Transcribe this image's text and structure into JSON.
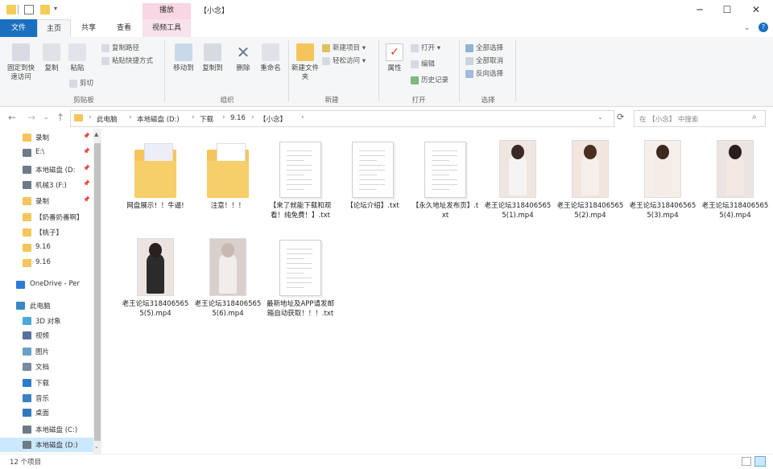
{
  "window": {
    "title": "【小念】",
    "context_tab_header": "播放",
    "buttons": {
      "minimize": "─",
      "maximize": "☐",
      "close": "✕"
    }
  },
  "ribbon_tabs": [
    "文件",
    "主页",
    "共享",
    "查看",
    "视频工具"
  ],
  "ribbon": {
    "clipboard": {
      "pin": "固定到快速访问",
      "copy": "复制",
      "paste": "粘贴",
      "copy_path": "复制路径",
      "paste_shortcut": "粘贴快捷方式",
      "cut": "剪切",
      "label": "剪贴板"
    },
    "organize": {
      "move_to": "移动到",
      "copy_to": "复制到",
      "delete": "删除",
      "rename": "重命名",
      "label": "组织"
    },
    "new": {
      "new_folder": "新建文件夹",
      "new_item": "新建项目",
      "easy_access": "轻松访问",
      "label": "新建"
    },
    "open": {
      "properties": "属性",
      "open": "打开",
      "edit": "编辑",
      "history": "历史记录",
      "label": "打开"
    },
    "select": {
      "select_all": "全部选择",
      "select_none": "全部取消",
      "invert": "反向选择",
      "label": "选择"
    }
  },
  "address": {
    "crumbs": [
      "此电脑",
      "本地磁盘 (D:)",
      "下载",
      "9.16",
      "【小念】"
    ],
    "search_placeholder": "在 【小念】 中搜索"
  },
  "sidebar": [
    {
      "label": "录制",
      "icon": "folder-icon",
      "pinned": true
    },
    {
      "label": "E:\\",
      "icon": "drive-icon",
      "pinned": true
    },
    {
      "label": "本地磁盘 (D:",
      "icon": "drive-icon",
      "pinned": true
    },
    {
      "label": "机械3 (F:)",
      "icon": "drive-icon",
      "pinned": true
    },
    {
      "label": "录制",
      "icon": "folder-icon",
      "pinned": true
    },
    {
      "label": "【奶番奶番啊】",
      "icon": "folder-icon",
      "pinned": false
    },
    {
      "label": "【桃子】",
      "icon": "folder-icon",
      "pinned": false
    },
    {
      "label": "9.16",
      "icon": "folder-icon",
      "pinned": false
    },
    {
      "label": "9.16",
      "icon": "folder-icon",
      "pinned": false
    },
    {
      "label": "OneDrive - Pers",
      "icon": "cloud-icon",
      "pinned": false
    },
    {
      "label": "此电脑",
      "icon": "computer-icon",
      "pinned": false
    },
    {
      "label": "3D 对象",
      "icon": "cube-icon",
      "pinned": false
    },
    {
      "label": "视频",
      "icon": "video-icon",
      "pinned": false
    },
    {
      "label": "图片",
      "icon": "picture-icon",
      "pinned": false
    },
    {
      "label": "文档",
      "icon": "document-icon",
      "pinned": false
    },
    {
      "label": "下载",
      "icon": "download-icon",
      "pinned": false
    },
    {
      "label": "音乐",
      "icon": "music-icon",
      "pinned": false
    },
    {
      "label": "桌面",
      "icon": "desktop-icon",
      "pinned": false
    },
    {
      "label": "本地磁盘 (C:)",
      "icon": "drive-icon",
      "pinned": false
    },
    {
      "label": "本地磁盘 (D:)",
      "icon": "drive-icon",
      "pinned": false
    }
  ],
  "files": [
    {
      "name": "网盘展示！！牛逼!",
      "type": "folder"
    },
    {
      "name": "注意！！！",
      "type": "folder"
    },
    {
      "name": "【来了就能下载和观看！纯免费！】.txt",
      "type": "txt"
    },
    {
      "name": "【论坛介绍】.txt",
      "type": "txt"
    },
    {
      "name": "【永久地址发布页】.txt",
      "type": "txt"
    },
    {
      "name": "老王论坛3184065655(1).mp4",
      "type": "video"
    },
    {
      "name": "老王论坛3184065655(2).mp4",
      "type": "video"
    },
    {
      "name": "老王论坛3184065655(3).mp4",
      "type": "video"
    },
    {
      "name": "老王论坛3184065655(4).mp4",
      "type": "video"
    },
    {
      "name": "老王论坛3184065655(5).mp4",
      "type": "video"
    },
    {
      "name": "老王论坛3184065655(6).mp4",
      "type": "video"
    },
    {
      "name": "最新地址及APP请发邮箱自动获取！！！.txt",
      "type": "txt"
    }
  ],
  "status": {
    "item_count": "12 个项目"
  },
  "colors": {
    "accent": "#1a6fc0",
    "folder": "#f4c55b",
    "context_tab": "#f8d6e4",
    "selection": "#cce8ff"
  }
}
